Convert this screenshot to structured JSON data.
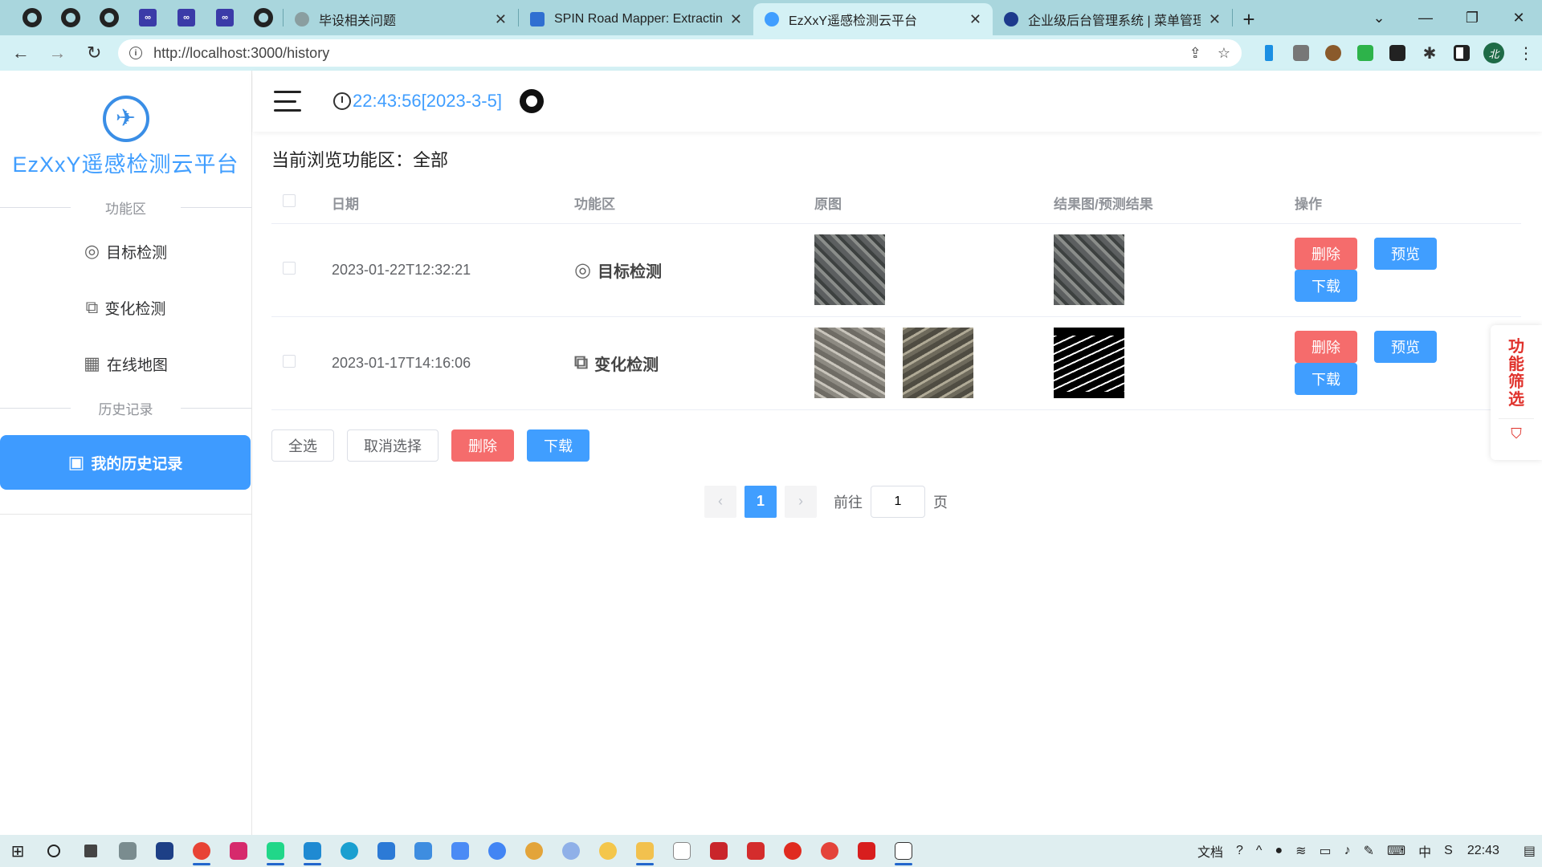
{
  "browser": {
    "tabs": [
      {
        "title": "毕设相关问题",
        "close": "✕",
        "icon_color": "#8a9ea0"
      },
      {
        "title": "SPIN Road Mapper: Extracting",
        "close": "✕",
        "icon_color": "#2f6fd1"
      },
      {
        "title": "EzXxY遥感检测云平台",
        "close": "✕",
        "icon_color": "#409eff"
      },
      {
        "title": "企业级后台管理系统 | 菜单管理",
        "close": "✕",
        "icon_color": "#1d3a8c"
      }
    ],
    "url": "http://localhost:3000/history",
    "avatar_letter": "北"
  },
  "sidebar": {
    "logo_title": "EzXxY遥感检测云平台",
    "section_function": "功能区",
    "items": [
      {
        "label": "目标检测",
        "icon": "target-icon"
      },
      {
        "label": "变化检测",
        "icon": "change-icon"
      },
      {
        "label": "在线地图",
        "icon": "map-icon"
      }
    ],
    "section_history": "历史记录",
    "active_item": {
      "label": "我的历史记录",
      "icon": "history-icon"
    }
  },
  "header": {
    "time": "22:43:56[2023-3-5]"
  },
  "main": {
    "browse_title": "当前浏览功能区：全部",
    "columns": [
      "日期",
      "功能区",
      "原图",
      "结果图/预测结果",
      "操作"
    ],
    "rows": [
      {
        "date": "2023-01-22T12:32:21",
        "function": "目标检测",
        "function_icon": "target-icon"
      },
      {
        "date": "2023-01-17T14:16:06",
        "function": "变化检测",
        "function_icon": "change-icon"
      }
    ],
    "row_actions": {
      "delete": "删除",
      "preview": "预览",
      "download": "下载"
    },
    "bulk": {
      "select_all": "全选",
      "cancel": "取消选择",
      "delete": "删除",
      "download": "下载"
    },
    "pagination": {
      "current": "1",
      "goto_label": "前往",
      "goto_value": "1",
      "page_suffix": "页"
    }
  },
  "filter_widget": {
    "label": "功能筛选"
  },
  "taskbar": {
    "tray_label": "文档",
    "clock": "22:43"
  },
  "colors": {
    "accent": "#409eff",
    "danger": "#f56c6c",
    "tabbar": "#a9d6dd"
  }
}
